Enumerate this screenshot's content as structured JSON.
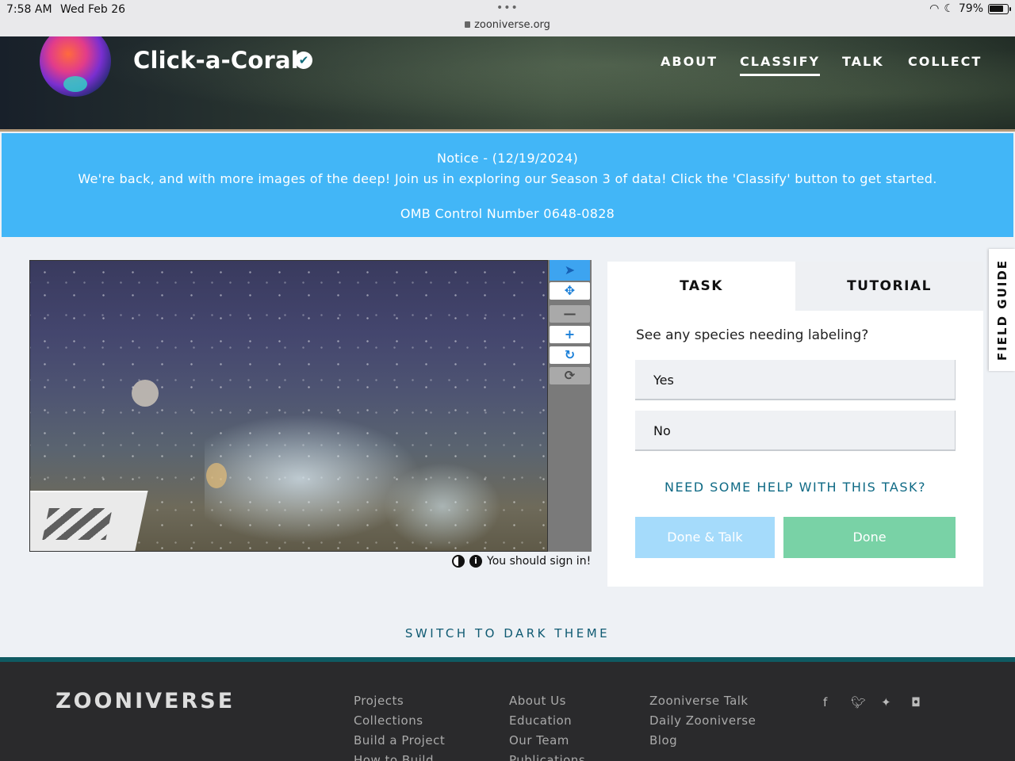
{
  "status_bar": {
    "time": "7:58 AM",
    "date": "Wed Feb 26",
    "dots": "•••",
    "url": "zooniverse.org",
    "battery": "79%"
  },
  "header": {
    "project_title": "Click-a-Coral",
    "verified_icon": "✔",
    "nav": [
      {
        "label": "ABOUT",
        "active": false
      },
      {
        "label": "CLASSIFY",
        "active": true
      },
      {
        "label": "TALK",
        "active": false
      },
      {
        "label": "COLLECT",
        "active": false
      }
    ]
  },
  "notice": {
    "line1": "Notice - (12/19/2024)",
    "line2": "We're back, and with more images of the deep! Join us in exploring our Season 3 of data! Click the 'Classify' button to get started.",
    "line3": "OMB Control Number 0648-0828"
  },
  "viewer": {
    "tools": [
      {
        "icon": "pointer-icon",
        "glyph": "➤"
      },
      {
        "icon": "pan-icon",
        "glyph": "✥"
      },
      {
        "icon": "zoom-out-icon",
        "glyph": "—"
      },
      {
        "icon": "zoom-in-icon",
        "glyph": "+"
      },
      {
        "icon": "rotate-icon",
        "glyph": "↻"
      },
      {
        "icon": "reset-icon",
        "glyph": "⟳"
      }
    ],
    "sign_in_text": "You should sign in!"
  },
  "task_panel": {
    "tabs": [
      "TASK",
      "TUTORIAL"
    ],
    "question": "See any species needing labeling?",
    "answers": [
      "Yes",
      "No"
    ],
    "help_link": "NEED SOME HELP WITH THIS TASK?",
    "done_talk": "Done & Talk",
    "done": "Done"
  },
  "field_guide": "FIELD GUIDE",
  "theme_toggle": "SWITCH TO DARK THEME",
  "footer": {
    "logo": "ZOONIVERSE",
    "col1": [
      "Projects",
      "Collections",
      "Build a Project",
      "How to Build"
    ],
    "col2": [
      "About Us",
      "Education",
      "Our Team",
      "Publications"
    ],
    "col3": [
      "Zooniverse Talk",
      "Daily Zooniverse",
      "Blog"
    ],
    "social": [
      "facebook-icon",
      "twitter-icon",
      "bluesky-icon",
      "instagram-icon"
    ]
  },
  "colors": {
    "notice_bg": "#42b6f7",
    "done_green": "#79d2a6",
    "done_talk_blue": "#a5dbfb",
    "link_teal": "#0f6a85",
    "footer_bg": "#2a2a2c"
  }
}
